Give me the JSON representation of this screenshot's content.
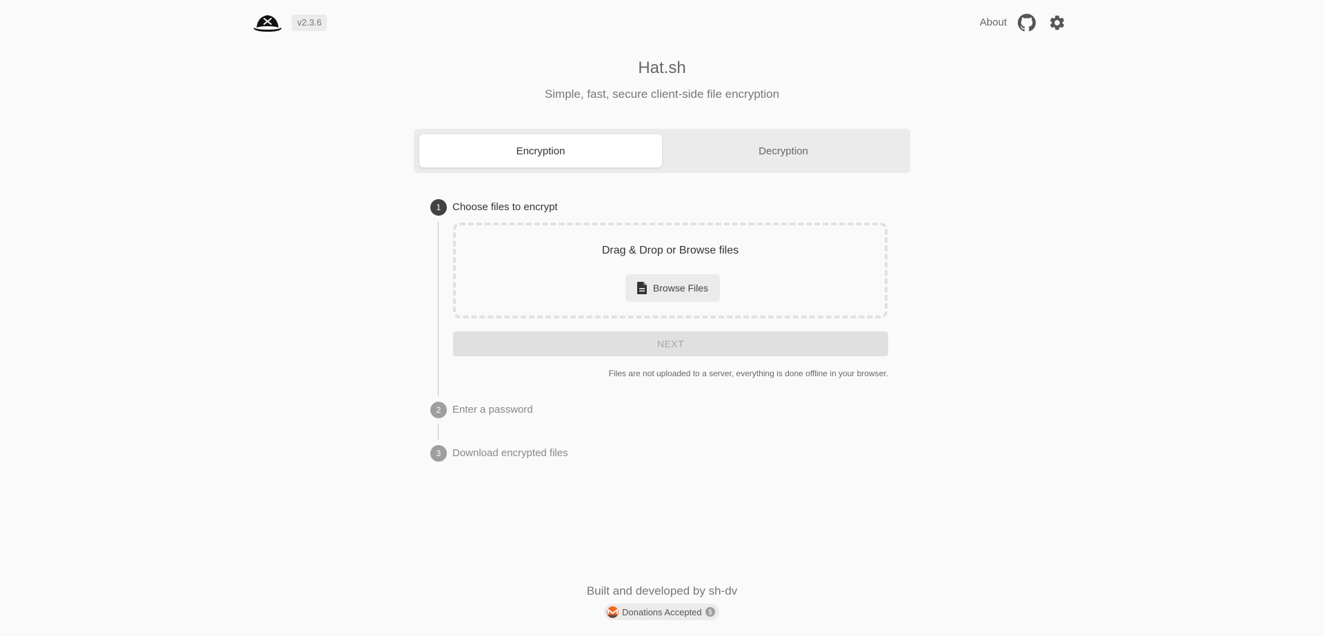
{
  "header": {
    "version": "v2.3.6",
    "about_label": "About"
  },
  "hero": {
    "title": "Hat.sh",
    "subtitle": "Simple, fast, secure client-side file encryption"
  },
  "tabs": [
    {
      "label": "Encryption",
      "active": true
    },
    {
      "label": "Decryption",
      "active": false
    }
  ],
  "steps": [
    {
      "number": "1",
      "label": "Choose files to encrypt",
      "active": true
    },
    {
      "number": "2",
      "label": "Enter a password",
      "active": false
    },
    {
      "number": "3",
      "label": "Download encrypted files",
      "active": false
    }
  ],
  "dropzone": {
    "text": "Drag & Drop or Browse files",
    "browse_label": "Browse Files"
  },
  "next_label": "NEXT",
  "note": "Files are not uploaded to a server, everything is done offline in your browser.",
  "footer": {
    "text": "Built and developed by sh-dv",
    "donate_label": "Donations Accepted"
  },
  "colors": {
    "background": "#fafafa",
    "active_step": "#424242",
    "inactive_step": "#9e9e9e",
    "monero": "#f26822"
  },
  "icons": [
    "pirate-hat-icon",
    "github-icon",
    "gear-icon",
    "file-icon",
    "monero-icon",
    "dollar-icon"
  ]
}
